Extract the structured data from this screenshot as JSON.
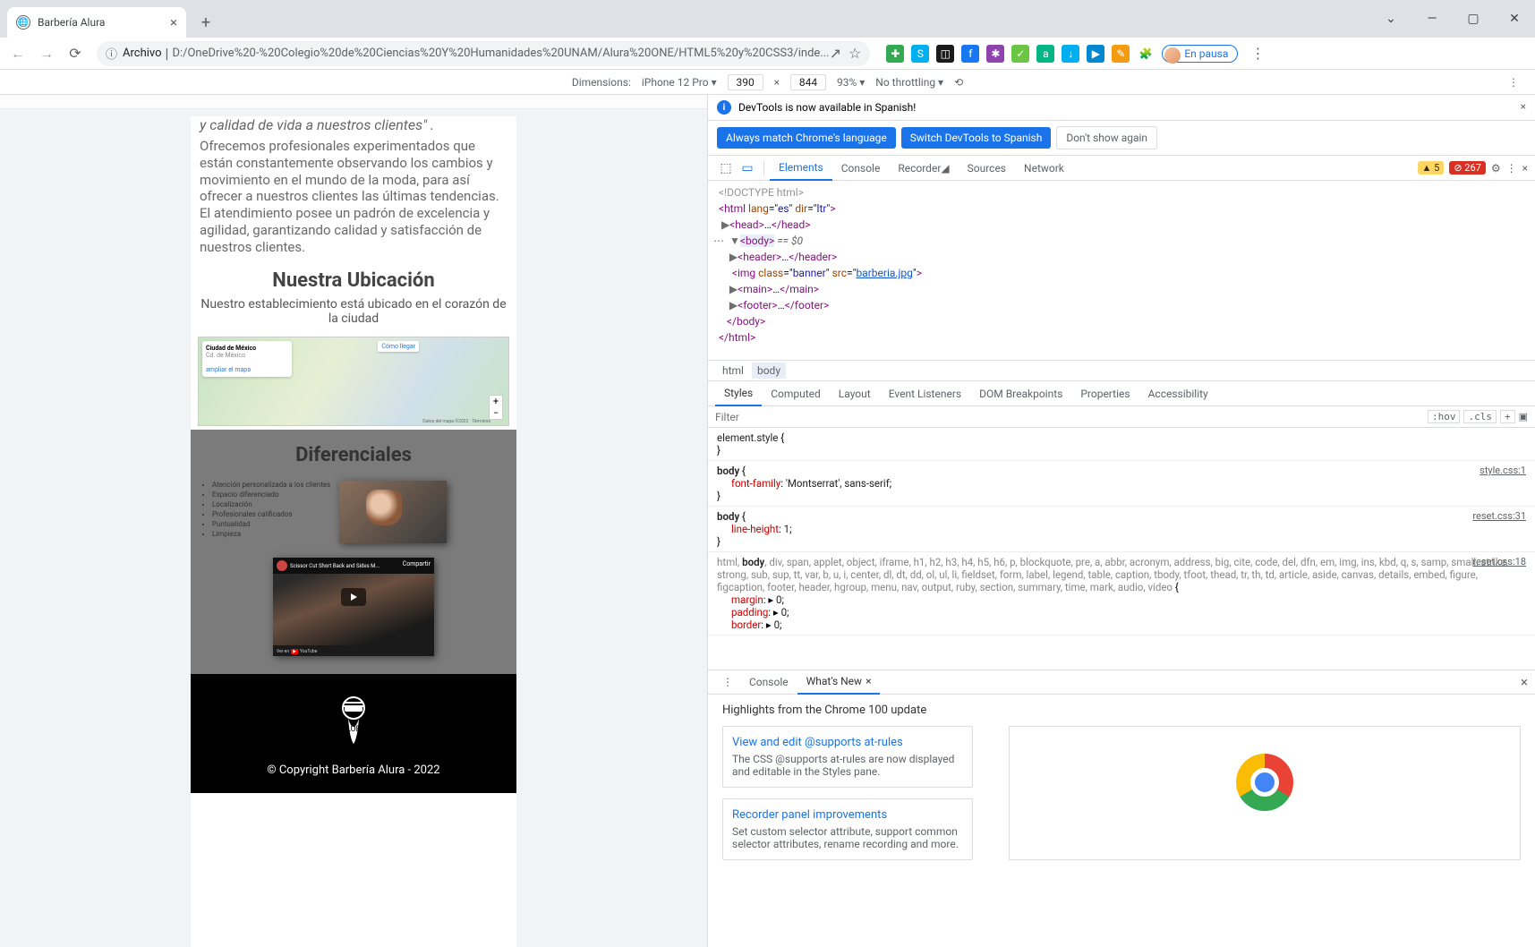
{
  "window": {
    "tab_title": "Barbería Alura"
  },
  "toolbar": {
    "archivo_label": "Archivo",
    "url": "D:/OneDrive%20-%20Colegio%20de%20Ciencias%20Y%20Humanidades%20UNAM/Alura%20ONE/HTML5%20y%20CSS3/inde...",
    "pause_label": "En pausa"
  },
  "device_bar": {
    "dimensions_label": "Dimensions:",
    "device": "iPhone 12 Pro",
    "width": "390",
    "height": "844",
    "zoom": "93%",
    "throttling": "No throttling"
  },
  "page": {
    "quote": "y calidad de vida a nuestros clientes\" .",
    "paragraph": "Ofrecemos profesionales experimentados que están constantemente observando los cambios y movimiento en el mundo de la moda, para así ofrecer a nuestros clientes las últimas tendencias. El atendimiento posee un padrón de excelencia y agilidad, garantizando calidad y satisfacción de nuestros clientes.",
    "location_heading": "Nuestra Ubicación",
    "location_sub": "Nuestro establecimiento está ubicado en el corazón de la ciudad",
    "map": {
      "card_title": "Ciudad de México",
      "card_sub": "Cd. de México",
      "card_link": "ampliar el mapa",
      "button": "Cómo llegar"
    },
    "dif_heading": "Diferenciales",
    "dif_items": [
      "Atención personalizada a los clientes",
      "Espacio diferenciado",
      "Localización",
      "Profesionales calificados",
      "Puntualidad",
      "Limpieza"
    ],
    "video_title": "Scissor Cut Short Back and Sides M...",
    "video_watch_label": "Ver en",
    "video_yt": "YouTube",
    "video_share": "Compartir",
    "copyright": "© Copyright Barbería Alura - 2022"
  },
  "devtools": {
    "notice": "DevTools is now available in Spanish!",
    "btn_match": "Always match Chrome's language",
    "btn_switch": "Switch DevTools to Spanish",
    "btn_dontshow": "Don't show again",
    "tabs": {
      "elements": "Elements",
      "console": "Console",
      "recorder": "Recorder",
      "sources": "Sources",
      "network": "Network"
    },
    "warnings": "5",
    "errors": "267",
    "dom": {
      "doctype": "<!DOCTYPE html>",
      "html_open": "html",
      "html_lang": "es",
      "html_dir": "ltr",
      "head": "head",
      "body": "body",
      "body_eq": " == $0",
      "header": "header",
      "img_tag": "img",
      "img_class": "banner",
      "img_src": "barberia.jpg",
      "main": "main",
      "footer": "footer"
    },
    "breadcrumb": {
      "html": "html",
      "body": "body"
    },
    "styles_tabs": {
      "styles": "Styles",
      "computed": "Computed",
      "layout": "Layout",
      "events": "Event Listeners",
      "dom_bp": "DOM Breakpoints",
      "props": "Properties",
      "a11y": "Accessibility"
    },
    "filter_placeholder": "Filter",
    "hov": ":hov",
    "cls": ".cls",
    "rules": {
      "element_style": "element.style",
      "style_origin": "style.css:1",
      "font_family_prop": "font-family",
      "font_family_val": "'Montserrat', sans-serif",
      "reset_origin": "reset.css:31",
      "line_height_prop": "line-height",
      "line_height_val": "1",
      "reset18_origin": "reset.css:18",
      "big_selector": "html, body, div, span, applet, object, iframe, h1, h2, h3, h4, h5, h6, p, blockquote, pre, a, abbr, acronym, address, big, cite, code, del, dfn, em, img, ins, kbd, q, s, samp, small, strike, strong, sub, sup, tt, var, b, u, i, center, dl, dt, dd, ol, ul, li, fieldset, form, label, legend, table, caption, tbody, tfoot, thead, tr, th, td, article, aside, canvas, details, embed, figure, figcaption, footer, header, hgroup, menu, nav, output, ruby, section, summary, time, mark, audio, video",
      "margin_prop": "margin",
      "margin_val": "0",
      "padding_prop": "padding",
      "padding_val": "0",
      "border_prop": "border",
      "border_val": "0"
    },
    "drawer": {
      "console": "Console",
      "whatsnew": "What's New"
    },
    "whatsnew": {
      "title": "Highlights from the Chrome 100 update",
      "card1_title": "View and edit @supports at-rules",
      "card1_desc": "The CSS @supports at-rules are now displayed and editable in the Styles pane.",
      "card2_title": "Recorder panel improvements",
      "card2_desc": "Set custom selector attribute, support common selector attributes, rename recording and more."
    }
  }
}
